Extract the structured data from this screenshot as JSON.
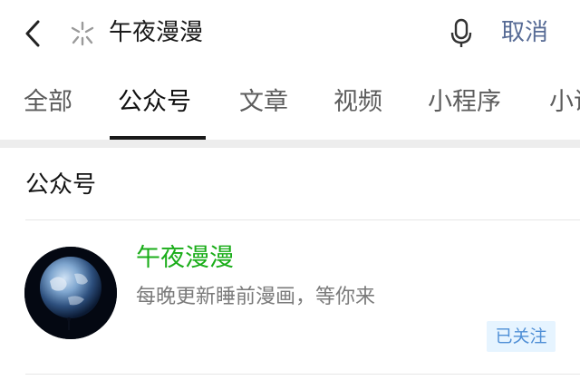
{
  "search": {
    "query": "午夜漫漫",
    "cancel_label": "取消"
  },
  "icons": {
    "back": "back-arrow-icon",
    "wechat_search": "wechat-search-icon",
    "voice": "microphone-icon"
  },
  "tabs": [
    {
      "label": "全部",
      "active": false
    },
    {
      "label": "公众号",
      "active": true
    },
    {
      "label": "文章",
      "active": false
    },
    {
      "label": "视频",
      "active": false
    },
    {
      "label": "小程序",
      "active": false
    },
    {
      "label": "小说",
      "active": false
    }
  ],
  "section": {
    "title": "公众号"
  },
  "result": {
    "name": "午夜漫漫",
    "description": "每晚更新睡前漫画，等你来",
    "follow_status": "已关注"
  },
  "colors": {
    "accent_green": "#1aad19",
    "link_blue": "#576b95",
    "badge_bg": "#e6f4ff",
    "badge_text": "#4f8fd6"
  }
}
